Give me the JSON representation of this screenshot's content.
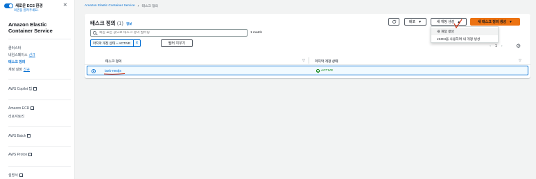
{
  "sidebar": {
    "toggle_label": "새로운 ECS 환경",
    "feedback_link": "의견을 알려주세요.",
    "service_title": "Amazon Elastic Container Service",
    "items": {
      "clusters": "클러스터",
      "namespaces": "네임스페이스",
      "namespaces_badge": "신규",
      "task_definitions": "태스크 정의",
      "account_settings": "계정 설정",
      "account_settings_badge": "신규",
      "copilot": "AWS Copilot 팁",
      "ecr": "Amazon ECR",
      "repositories": "리포지토리",
      "batch": "AWS Batch",
      "proton": "AWS Proton",
      "docs": "설명서"
    }
  },
  "breadcrumb": {
    "service": "Amazon Elastic Container Service",
    "current": "태스크 정의"
  },
  "panel": {
    "title": "태스크 정의",
    "count": "(1)",
    "info": "정보",
    "refresh_icon": "refresh-icon",
    "deploy_label": "배포",
    "create_revision_label": "새 개정 생성",
    "create_new_label": "새 태스크 정의 생성",
    "dropdown_items": [
      "새 개정 생성",
      "JSON을 사용하여 새 개정 생성"
    ],
    "search_placeholder": "복원 표는 값으로 태스크 정의 필터링",
    "match_count": "1 match",
    "filter_token": "마지막 개정 상태 = ACTIVE",
    "clear_filters": "필터 지우기",
    "page_number": "1",
    "columns": [
      "태스크 정의",
      "마지막 개정 상태"
    ],
    "rows": [
      {
        "name": "task-nestjs",
        "status": "ACTIVE"
      }
    ]
  },
  "colors": {
    "primary": "#ec7211",
    "link": "#0972d3",
    "success": "#037f0c",
    "annotation": "#d13212"
  }
}
